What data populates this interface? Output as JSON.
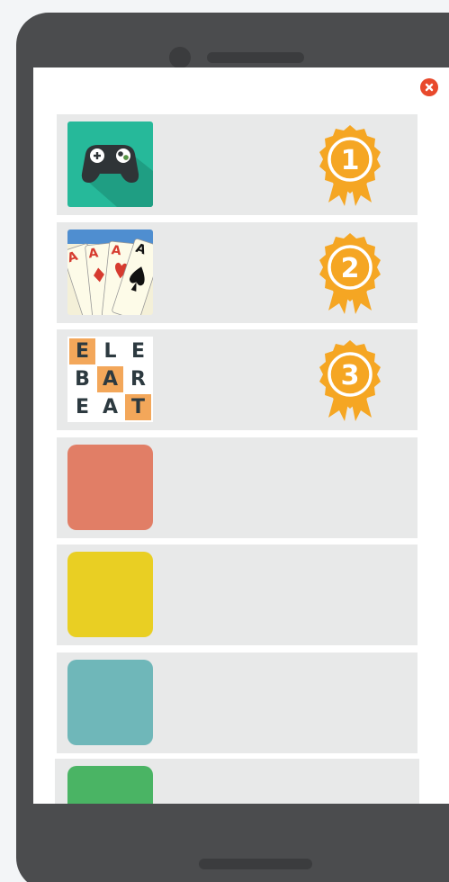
{
  "screen": {
    "close_icon": "close-icon"
  },
  "rows": [
    {
      "kind": "game-controller",
      "rank": "1",
      "color": "#26b99a"
    },
    {
      "kind": "playing-cards",
      "rank": "2"
    },
    {
      "kind": "word-grid",
      "rank": "3",
      "letters": [
        [
          "E",
          "L",
          "E"
        ],
        [
          "B",
          "A",
          "R"
        ],
        [
          "E",
          "A",
          "T"
        ]
      ]
    },
    {
      "kind": "placeholder",
      "color": "#e17e66"
    },
    {
      "kind": "placeholder",
      "color": "#e9cf23"
    },
    {
      "kind": "placeholder",
      "color": "#6fb7b9"
    },
    {
      "kind": "placeholder",
      "color": "#4ab464"
    }
  ],
  "colors": {
    "medal": "#f5a623",
    "row_bg": "#e8e9e9",
    "close": "#e8492c",
    "tile_orange": "#f3a75a"
  }
}
